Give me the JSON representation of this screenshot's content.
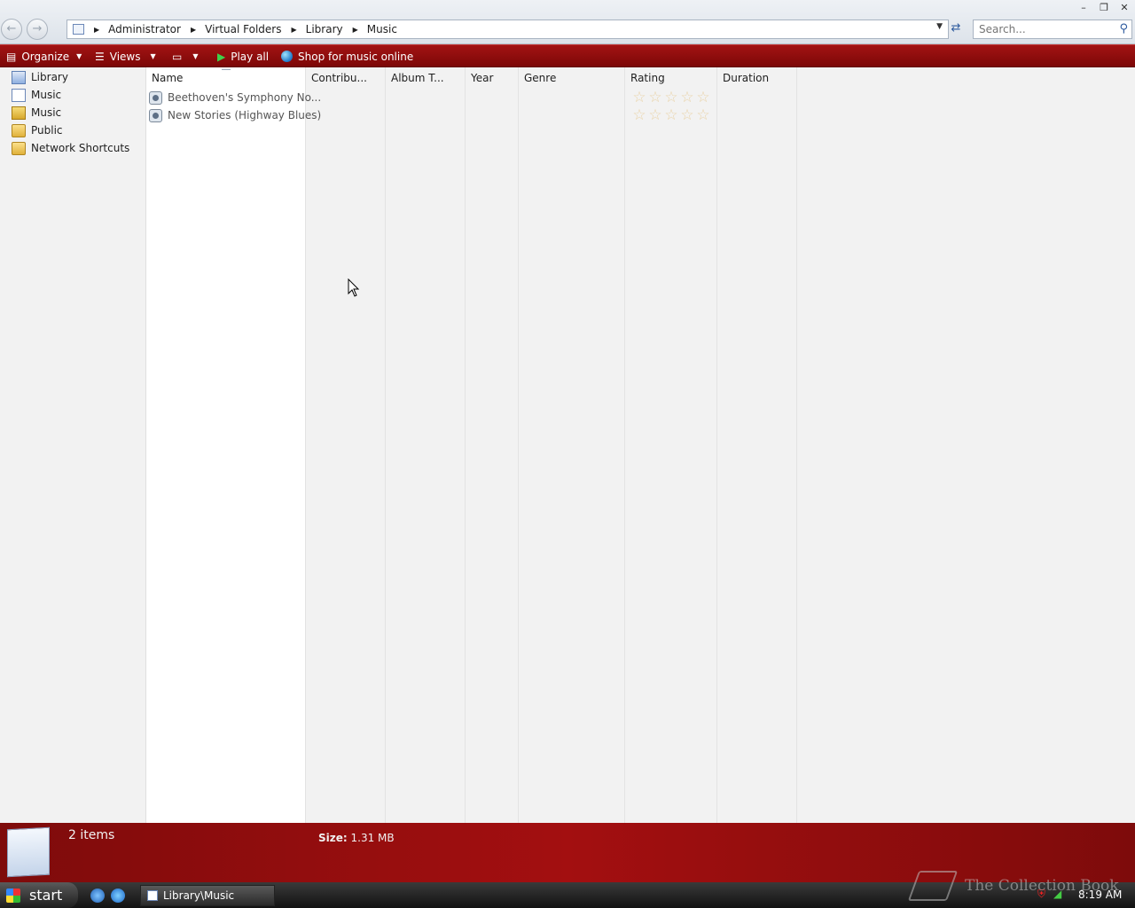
{
  "window": {
    "minimize_label": "–",
    "maximize_label": "❐",
    "close_label": "✕"
  },
  "address": {
    "crumbs": [
      "Administrator",
      "Virtual Folders",
      "Library",
      "Music"
    ]
  },
  "search": {
    "placeholder": "Search..."
  },
  "toolbar": {
    "organize": "Organize",
    "views": "Views",
    "play_all": "Play all",
    "shop": "Shop for music online"
  },
  "nav": {
    "items": [
      {
        "label": "Library",
        "icon": "library-icon"
      },
      {
        "label": "Music",
        "icon": "virtual-folder-icon"
      },
      {
        "label": "Music",
        "icon": "music-folder-icon"
      },
      {
        "label": "Public",
        "icon": "folder-icon"
      },
      {
        "label": "Network Shortcuts",
        "icon": "folder-icon"
      }
    ]
  },
  "columns": {
    "name": "Name",
    "contributing": "Contribu...",
    "album": "Album T...",
    "year": "Year",
    "genre": "Genre",
    "rating": "Rating",
    "duration": "Duration"
  },
  "files": [
    {
      "name": "Beethoven's Symphony No...",
      "rating": 0,
      "icon": "audio-file-icon"
    },
    {
      "name": "New Stories (Highway Blues)",
      "rating": 0,
      "icon": "audio-file-icon"
    }
  ],
  "details": {
    "count": "2 items",
    "size_label": "Size:",
    "size_value": "1.31 MB"
  },
  "taskbar": {
    "start": "start",
    "window_label": "Library\\Music",
    "clock": "8:19 AM"
  },
  "watermark": "The Collection Book",
  "colors": {
    "command_bar": "#8e0d0d",
    "details_pane": "#a30f10",
    "star_empty": "#e9d3a8"
  }
}
